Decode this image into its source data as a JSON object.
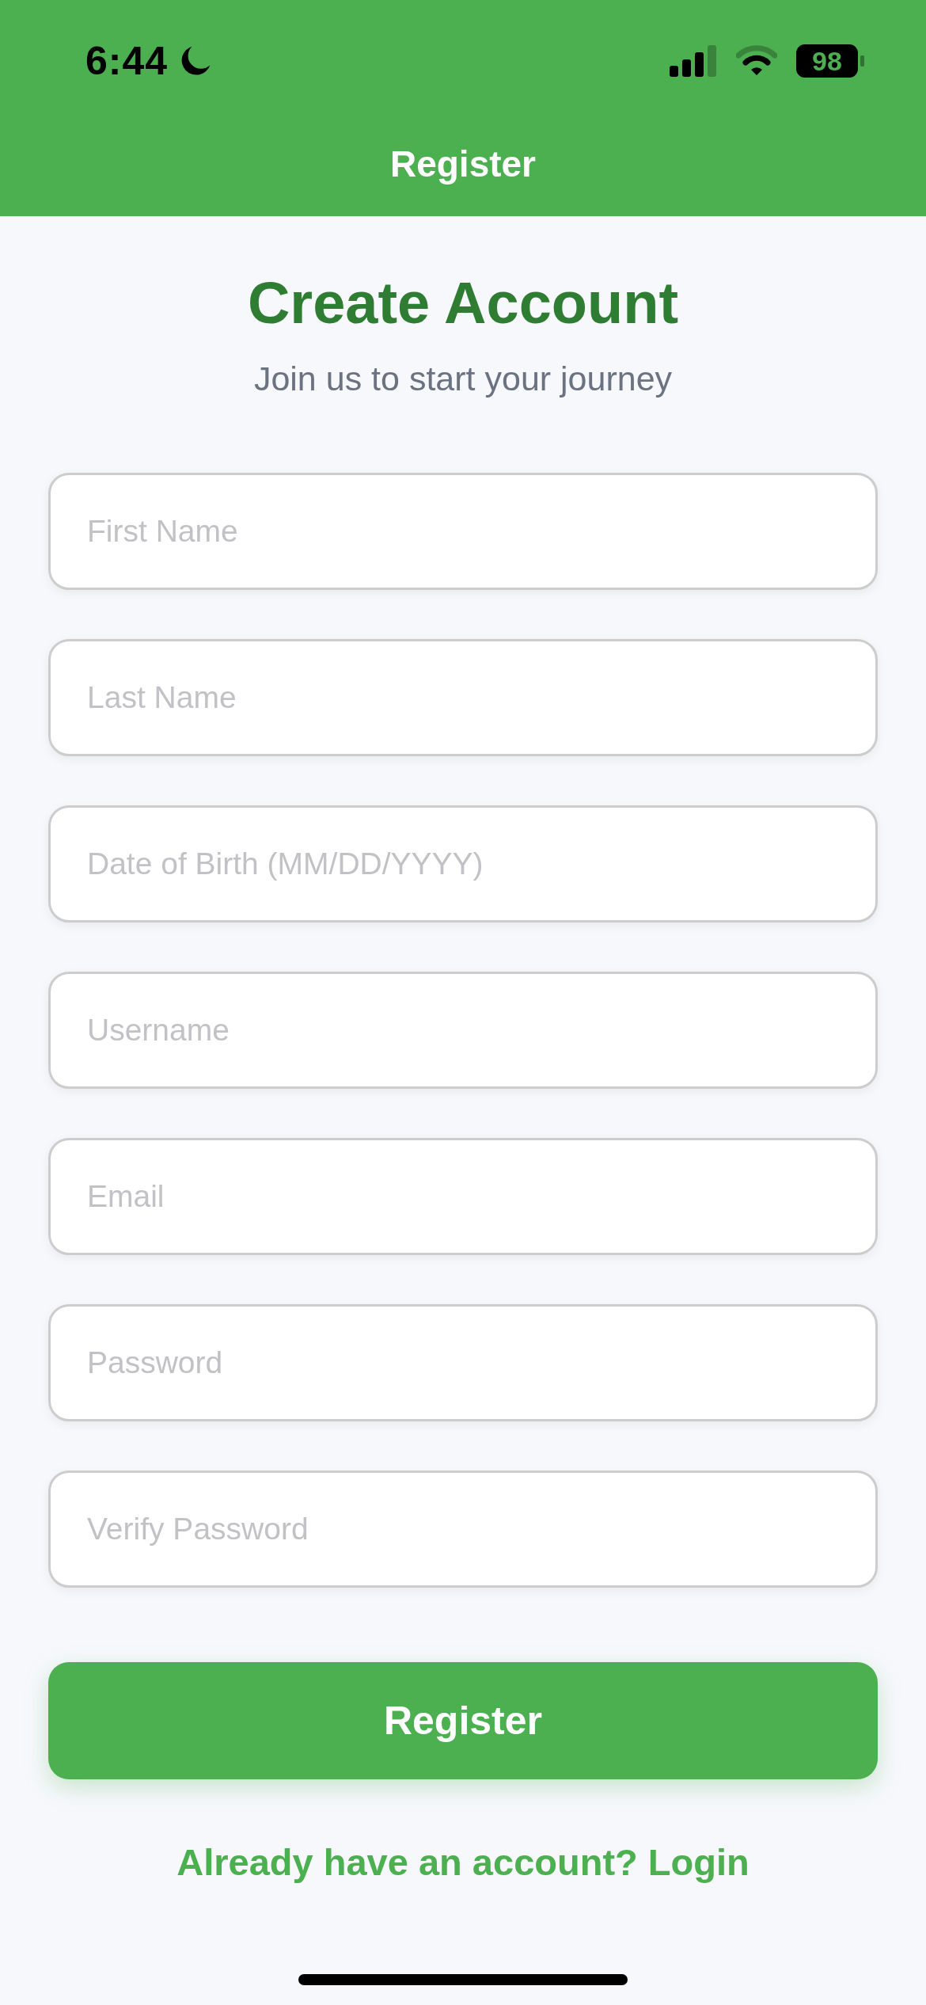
{
  "status_bar": {
    "time": "6:44",
    "battery": "98"
  },
  "nav_bar": {
    "title": "Register"
  },
  "heading": {
    "title": "Create Account",
    "subtitle": "Join us to start your journey"
  },
  "form": {
    "fields": [
      {
        "placeholder": "First Name"
      },
      {
        "placeholder": "Last Name"
      },
      {
        "placeholder": "Date of Birth (MM/DD/YYYY)"
      },
      {
        "placeholder": "Username"
      },
      {
        "placeholder": "Email"
      },
      {
        "placeholder": "Password"
      },
      {
        "placeholder": "Verify Password"
      }
    ]
  },
  "submit_button": {
    "label": "Register"
  },
  "login_link": {
    "label": "Already have an account? Login"
  }
}
